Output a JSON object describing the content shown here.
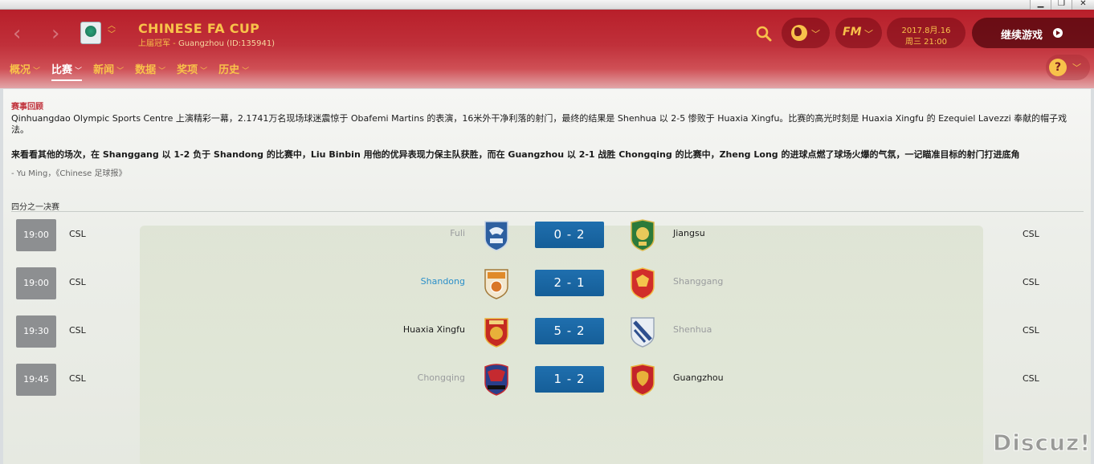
{
  "window": {
    "minimize": "▁",
    "restore": "❐",
    "close": "✕"
  },
  "header": {
    "competition_title": "CHINESE FA CUP",
    "competition_sub_champ": "上届冠军 - ",
    "competition_sub_detail": "Guangzhou (ID:135941)",
    "date_line1": "2017.8月.16",
    "date_line2": "周三 21:00",
    "fm_label": "FM",
    "continue_label": "继续游戏",
    "help_label": "?"
  },
  "tabs": [
    {
      "label": "概况"
    },
    {
      "label": "比赛",
      "active": true
    },
    {
      "label": "新闻"
    },
    {
      "label": "数据"
    },
    {
      "label": "奖项"
    },
    {
      "label": "历史"
    }
  ],
  "report": {
    "section_title": "赛事回顾",
    "paragraph1": "Qinhuangdao Olympic Sports Centre 上演精彩一幕，2.1741万名现场球迷震惊于 Obafemi Martins 的表演，16米外干净利落的射门，最终的结果是 Shenhua 以 2-5 惨败于 Huaxia Xingfu。比赛的高光时刻是 Huaxia Xingfu 的 Ezequiel Lavezzi 奉献的帽子戏法。",
    "paragraph2": "来看看其他的场次，在 Shanggang 以 1-2 负于 Shandong 的比赛中，Liu Binbin 用他的优异表现力保主队获胜，而在 Guangzhou 以 2-1 战胜 Chongqing 的比赛中，Zheng Long 的进球点燃了球场火爆的气氛，一记瞄准目标的射门打进底角",
    "author": "- Yu Ming，《Chinese 足球报》"
  },
  "round_label": "四分之一决赛",
  "matches": [
    {
      "time": "19:00",
      "comp_left": "CSL",
      "home": "Fuli",
      "score": "0 - 2",
      "away": "Jiangsu",
      "comp_right": "CSL"
    },
    {
      "time": "19:00",
      "comp_left": "CSL",
      "home": "Shandong",
      "score": "2 - 1",
      "away": "Shanggang",
      "comp_right": "CSL"
    },
    {
      "time": "19:30",
      "comp_left": "CSL",
      "home": "Huaxia Xingfu",
      "score": "5 - 2",
      "away": "Shenhua",
      "comp_right": "CSL"
    },
    {
      "time": "19:45",
      "comp_left": "CSL",
      "home": "Chongqing",
      "score": "1 - 2",
      "away": "Guangzhou",
      "comp_right": "CSL"
    }
  ],
  "watermark": "Discuz!",
  "colors": {
    "header_red": "#b81f2a",
    "accent_gold": "#f8c24a",
    "score_blue": "#1f6fae",
    "link_blue": "#2b8fc9"
  }
}
